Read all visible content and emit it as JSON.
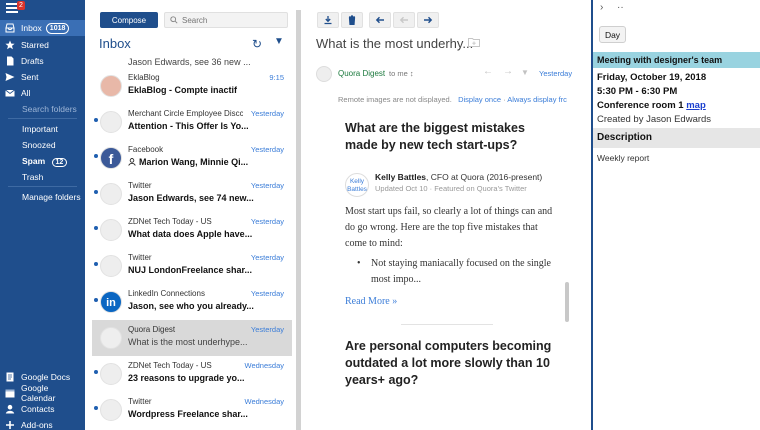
{
  "colors": {
    "nav_bg": "#1f4e8c",
    "accent_link": "#3b7dd8",
    "unread_dot": "#1f5fb0",
    "event_header": "#99d3e0",
    "sender_green": "#1c7a3e"
  },
  "nav": {
    "badge": "2",
    "items": [
      {
        "label": "Inbox",
        "count": "1018",
        "icon": "inbox-icon"
      },
      {
        "label": "Starred",
        "icon": "star-icon"
      },
      {
        "label": "Drafts",
        "icon": "drafts-icon"
      },
      {
        "label": "Sent",
        "icon": "sent-icon"
      },
      {
        "label": "All",
        "icon": "mail-icon"
      }
    ],
    "search_folders": "Search folders",
    "sub": [
      "Important",
      "Snoozed",
      "Spam",
      "Trash"
    ],
    "spam_count": "12",
    "manage": "Manage folders",
    "apps": [
      {
        "label": "Google Docs",
        "icon": "docs-icon"
      },
      {
        "label": "Google Calendar",
        "icon": "calendar-icon"
      },
      {
        "label": "Contacts",
        "icon": "contacts-icon"
      },
      {
        "label": "Add-ons",
        "icon": "addons-icon"
      }
    ]
  },
  "list": {
    "compose": "Compose",
    "search_placeholder": "Search",
    "folder_title": "Inbox",
    "rows": [
      {
        "sender": "",
        "subject": "Jason Edwards, see 36 new ...",
        "time": ""
      },
      {
        "sender": "EklaBlog",
        "subject": "EklaBlog - Compte inactif",
        "time": "9:15"
      },
      {
        "sender": "Merchant Circle Employee Discc",
        "subject": "Attention - This Offer Is Yo...",
        "time": "Yesterday"
      },
      {
        "sender": "Facebook",
        "subject": "Marion Wang, Minnie Qi...",
        "time": "Yesterday"
      },
      {
        "sender": "Twitter",
        "subject": "Jason Edwards, see 74 new...",
        "time": "Yesterday"
      },
      {
        "sender": "ZDNet Tech Today - US",
        "subject": "What data does Apple have...",
        "time": "Yesterday"
      },
      {
        "sender": "Twitter",
        "subject": "NUJ LondonFreelance shar...",
        "time": "Yesterday"
      },
      {
        "sender": "LinkedIn Connections",
        "subject": "Jason, see who you already...",
        "time": "Yesterday"
      },
      {
        "sender": "Quora Digest",
        "subject": "What is the most underhype...",
        "time": "Yesterday"
      },
      {
        "sender": "ZDNet Tech Today - US",
        "subject": "23 reasons to upgrade yo...",
        "time": "Wednesday"
      },
      {
        "sender": "Twitter",
        "subject": "Wordpress Freelance shar...",
        "time": "Wednesday"
      }
    ]
  },
  "reader": {
    "subject": "What is the most underhy...",
    "from": "Quora Digest",
    "to": "to me",
    "time": "Yesterday",
    "remote_notice": "Remote images are not displayed.",
    "display_once": "Display once",
    "always_display": "Always display frc",
    "q1_title": "What are the biggest mistakes made by new tech start-ups?",
    "avatar_text": "Kelly Battles",
    "author": "Kelly Battles",
    "author_role": ", CFO at Quora (2016-present)",
    "updated": "Updated Oct 10 · Featured on Quora's Twitter",
    "body": "Most start ups fail, so clearly a lot of things can and do go wrong. Here are the top five mistakes that come to mind:",
    "bullet": "Not staying maniacally focused on the single most impo...",
    "read_more": "Read More »",
    "q2_title": "Are personal computers becoming outdated a lot more slowly than 10 years+ ago?"
  },
  "event": {
    "nav_prev": "›",
    "nav_next": "··",
    "day_button": "Day",
    "title": "Meeting with designer's team",
    "date": "Friday, October 19, 2018",
    "time": "5:30 PM - 6:30 PM",
    "location": "Conference room 1",
    "map_link": "map",
    "created_by": "Created by Jason Edwards",
    "description_heading": "Description",
    "description": "Weekly report"
  }
}
